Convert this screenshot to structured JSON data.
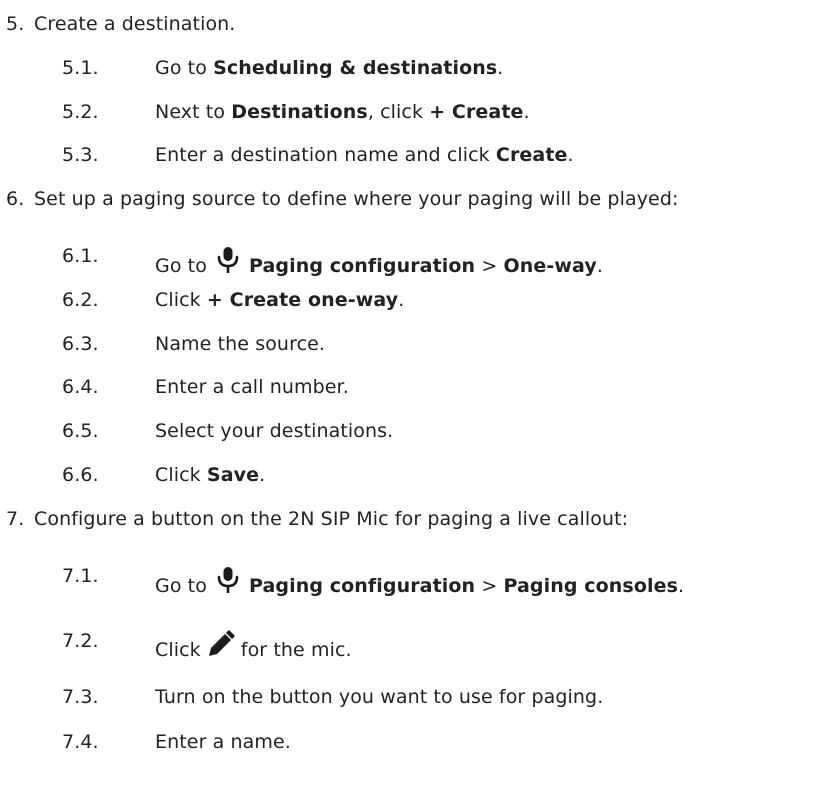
{
  "steps": [
    {
      "num": "5.",
      "text": "Create a destination.",
      "substeps": [
        {
          "num": "5.1.",
          "pre": "Go to ",
          "b1": "Scheduling & destinations",
          "post": "."
        },
        {
          "num": "5.2.",
          "pre": "Next to ",
          "b1": "Destinations",
          "mid": ", click ",
          "b2": "+ Create",
          "post": "."
        },
        {
          "num": "5.3.",
          "pre": "Enter a destination name and click ",
          "b1": "Create",
          "post": "."
        }
      ]
    },
    {
      "num": "6.",
      "text": "Set up a paging source to define where your paging will be played:",
      "substeps": [
        {
          "num": "6.1.",
          "pre": "Go to",
          "icon": "microphone-icon",
          "b1": "Paging configuration",
          "mid": " > ",
          "b2": "One-way",
          "post": "."
        },
        {
          "num": "6.2.",
          "pre": "Click ",
          "b1": "+ Create one-way",
          "post": "."
        },
        {
          "num": "6.3.",
          "pre": "Name the source."
        },
        {
          "num": "6.4.",
          "pre": "Enter a call number."
        },
        {
          "num": "6.5.",
          "pre": "Select your destinations."
        },
        {
          "num": "6.6.",
          "pre": "Click ",
          "b1": "Save",
          "post": "."
        }
      ]
    },
    {
      "num": "7.",
      "text": "Configure a button on the 2N SIP Mic for paging a live callout:",
      "substeps": [
        {
          "num": "7.1.",
          "pre": "Go to",
          "icon": "microphone-icon",
          "b1": "Paging configuration",
          "mid": " > ",
          "b2": "Paging consoles",
          "post": "."
        },
        {
          "num": "7.2.",
          "pre": "Click",
          "icon": "pencil-icon",
          "post": "for the mic."
        },
        {
          "num": "7.3.",
          "pre": "Turn on the button you want to use for paging."
        },
        {
          "num": "7.4.",
          "pre": "Enter a name."
        }
      ]
    }
  ]
}
